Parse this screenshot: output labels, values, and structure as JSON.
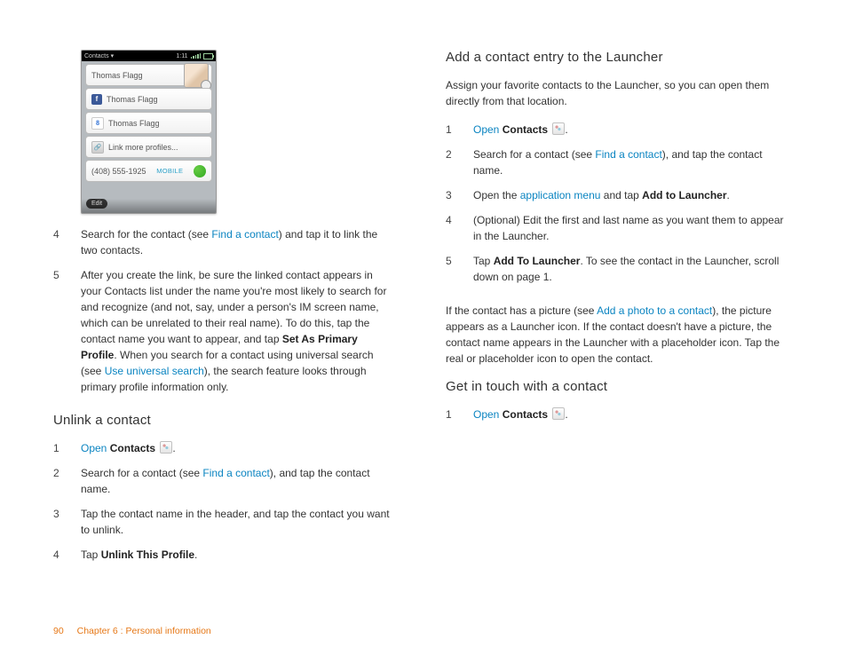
{
  "screenshot": {
    "status_left": "Contacts ▾",
    "status_time": "1:11",
    "row1": "Thomas Flagg",
    "row2": "Thomas Flagg",
    "row3": "Thomas Flagg",
    "row4": "Link more profiles...",
    "phone": "(408) 555-1925",
    "mobile": "MOBILE",
    "edit": "Edit",
    "badge2": "2",
    "fb": "f"
  },
  "left": {
    "step4": {
      "n": "4",
      "a": "Search for the contact (see ",
      "link": "Find a contact",
      "b": ") and tap it to link the two contacts."
    },
    "step5": {
      "n": "5",
      "a": "After you create the link, be sure the linked contact appears in your Contacts list under the name you're most likely to search for and recognize (and not, say, under a person's IM screen name, which can be unrelated to their real name). To do this, tap the contact name you want to appear, and tap ",
      "bold1": "Set As Primary Profile",
      "b": ". When you search for a contact using universal search (see ",
      "link": "Use universal search",
      "c": "), the search feature looks through primary profile information only."
    },
    "h_unlink": "Unlink a contact",
    "u1": {
      "n": "1",
      "link": "Open",
      "bold": " Contacts",
      "tail": " "
    },
    "u2": {
      "n": "2",
      "a": "Search for a contact (see ",
      "link": "Find a contact",
      "b": "), and tap the contact name."
    },
    "u3": {
      "n": "3",
      "t": "Tap the contact name in the header, and tap the contact you want to unlink."
    },
    "u4": {
      "n": "4",
      "a": "Tap ",
      "bold": "Unlink This Profile",
      "b": "."
    }
  },
  "right": {
    "h_add": "Add a contact entry to the Launcher",
    "p_add": "Assign your favorite contacts to the Launcher, so you can open them directly from that location.",
    "a1": {
      "n": "1",
      "link": "Open",
      "bold": " Contacts",
      "tail": " "
    },
    "a2": {
      "n": "2",
      "a": "Search for a contact (see ",
      "link": "Find a contact",
      "b": "), and tap the contact name."
    },
    "a3": {
      "n": "3",
      "a": "Open the ",
      "link": "application menu",
      "b": " and tap ",
      "bold": "Add to Launcher",
      "c": "."
    },
    "a4": {
      "n": "4",
      "t": "(Optional) Edit the first and last name as you want them to appear in the Launcher."
    },
    "a5": {
      "n": "5",
      "a": "Tap ",
      "bold": "Add To Launcher",
      "b": ". To see the contact in the Launcher, scroll down on page 1."
    },
    "p_pic_a": "If the contact has a picture (see ",
    "p_pic_link": "Add a photo to a contact",
    "p_pic_b": "), the picture appears as a Launcher icon. If the contact doesn't have a picture, the contact name appears in the Launcher with a placeholder icon. Tap the real or placeholder icon to open the contact.",
    "h_get": "Get in touch with a contact",
    "g1": {
      "n": "1",
      "link": "Open",
      "bold": " Contacts",
      "tail": " "
    }
  },
  "footer": {
    "page": "90",
    "chapter": "Chapter 6 : Personal information"
  }
}
